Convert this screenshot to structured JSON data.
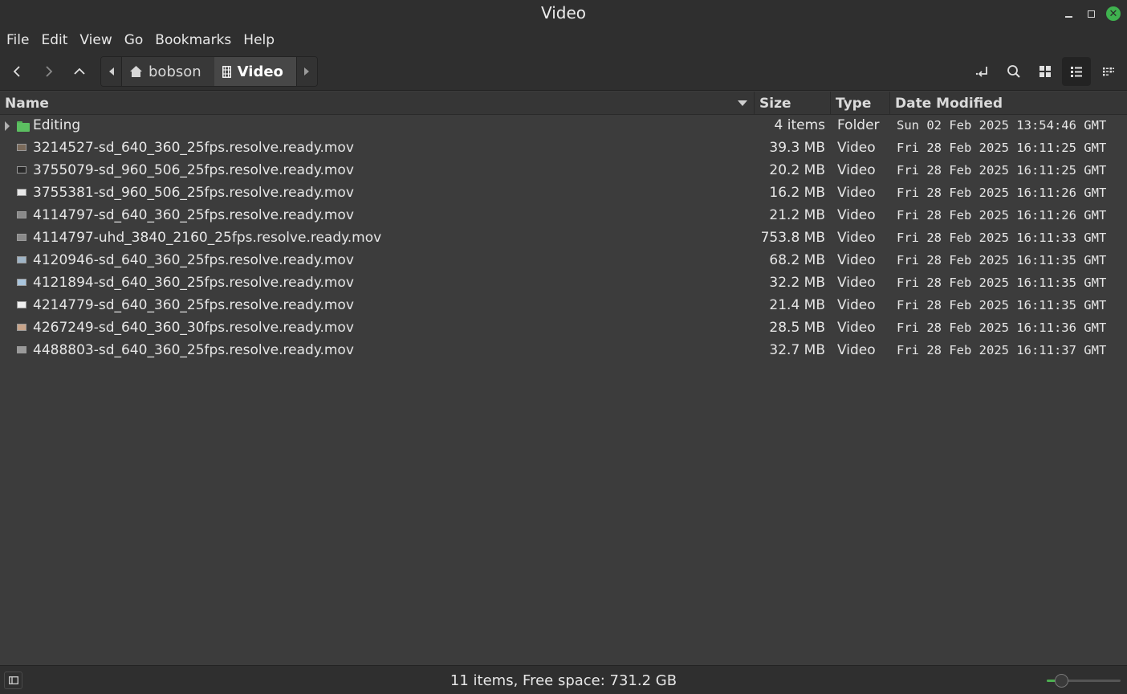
{
  "window": {
    "title": "Video"
  },
  "menu": [
    "File",
    "Edit",
    "View",
    "Go",
    "Bookmarks",
    "Help"
  ],
  "breadcrumb": {
    "home": "bobson",
    "current": "Video"
  },
  "columns": {
    "name": "Name",
    "size": "Size",
    "type": "Type",
    "date": "Date Modified"
  },
  "files": [
    {
      "name": "Editing",
      "size": "4 items",
      "type": "Folder",
      "date": "Sun 02 Feb 2025 13:54:46 GMT",
      "kind": "folder"
    },
    {
      "name": "3214527-sd_640_360_25fps.resolve.ready.mov",
      "size": "39.3 MB",
      "type": "Video",
      "date": "Fri 28 Feb 2025 16:11:25 GMT",
      "kind": "video"
    },
    {
      "name": "3755079-sd_960_506_25fps.resolve.ready.mov",
      "size": "20.2 MB",
      "type": "Video",
      "date": "Fri 28 Feb 2025 16:11:25 GMT",
      "kind": "video"
    },
    {
      "name": "3755381-sd_960_506_25fps.resolve.ready.mov",
      "size": "16.2 MB",
      "type": "Video",
      "date": "Fri 28 Feb 2025 16:11:26 GMT",
      "kind": "video"
    },
    {
      "name": "4114797-sd_640_360_25fps.resolve.ready.mov",
      "size": "21.2 MB",
      "type": "Video",
      "date": "Fri 28 Feb 2025 16:11:26 GMT",
      "kind": "video"
    },
    {
      "name": "4114797-uhd_3840_2160_25fps.resolve.ready.mov",
      "size": "753.8 MB",
      "type": "Video",
      "date": "Fri 28 Feb 2025 16:11:33 GMT",
      "kind": "video"
    },
    {
      "name": "4120946-sd_640_360_25fps.resolve.ready.mov",
      "size": "68.2 MB",
      "type": "Video",
      "date": "Fri 28 Feb 2025 16:11:35 GMT",
      "kind": "video"
    },
    {
      "name": "4121894-sd_640_360_25fps.resolve.ready.mov",
      "size": "32.2 MB",
      "type": "Video",
      "date": "Fri 28 Feb 2025 16:11:35 GMT",
      "kind": "video"
    },
    {
      "name": "4214779-sd_640_360_25fps.resolve.ready.mov",
      "size": "21.4 MB",
      "type": "Video",
      "date": "Fri 28 Feb 2025 16:11:35 GMT",
      "kind": "video"
    },
    {
      "name": "4267249-sd_640_360_30fps.resolve.ready.mov",
      "size": "28.5 MB",
      "type": "Video",
      "date": "Fri 28 Feb 2025 16:11:36 GMT",
      "kind": "video"
    },
    {
      "name": "4488803-sd_640_360_25fps.resolve.ready.mov",
      "size": "32.7 MB",
      "type": "Video",
      "date": "Fri 28 Feb 2025 16:11:37 GMT",
      "kind": "video"
    }
  ],
  "status": {
    "text": "11 items, Free space: 731.2 GB"
  },
  "zoom": {
    "level": 0.2
  },
  "colors": {
    "accent": "#3fb24f",
    "folder": "#5cbf61"
  }
}
